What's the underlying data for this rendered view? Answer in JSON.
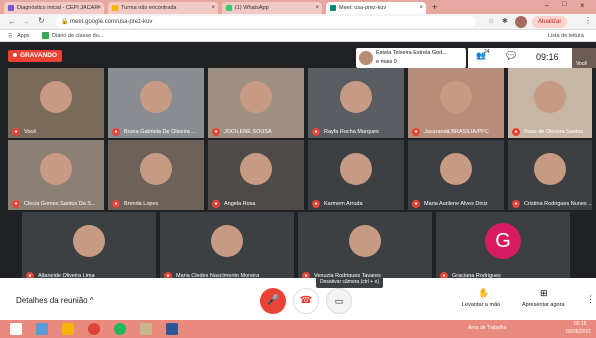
{
  "tabs": [
    {
      "label": "Diagnóstico inicial - CEPI JACAR",
      "color": "#7e57c2"
    },
    {
      "label": "Turma não encontrada",
      "color": "#f4b400"
    },
    {
      "label": "(1) WhatsApp",
      "color": "#25d366"
    },
    {
      "label": "Meet: usa-prez-kuv",
      "color": "#00897b"
    }
  ],
  "browser": {
    "url": "meet.google.com/usa-prez-kuv",
    "update_label": "Atualizar",
    "bookmarks": [
      "Apps",
      "Diário de classe do..."
    ],
    "reading_list": "Lista de leitura"
  },
  "meet": {
    "recording_label": "GRAVANDO",
    "presenter": {
      "line1": "Estela Teixeira Estrela God...",
      "line2": "e mais 9"
    },
    "participant_count": "24",
    "time": "09:16",
    "self_label": "Você",
    "participants": [
      {
        "name": "Você",
        "bg": "#7a6a5a"
      },
      {
        "name": "Bruna Gabriela De Oliveira ...",
        "bg": "#8a8e93"
      },
      {
        "name": "JOCILENE SOUSA",
        "bg": "#9e8f82"
      },
      {
        "name": "Rayfa Rocha Marques",
        "bg": "#5a5e63"
      },
      {
        "name": "Jacarandá BRASILIA/PPC",
        "bg": "#b58d7a"
      },
      {
        "name": "Rose de Oliveira Santos",
        "bg": "#c7b6a5"
      },
      {
        "name": "Clecia Gomes Santos Da S...",
        "bg": "#8c7f73"
      },
      {
        "name": "Brenda Lopes",
        "bg": "#6d625a"
      },
      {
        "name": "Angela Rosa",
        "bg": "#4e4a47"
      },
      {
        "name": "Karmem Arruda",
        "bg": "#3c4043"
      },
      {
        "name": "Maria Aurilene Alves Diniz",
        "bg": "#3c4043"
      },
      {
        "name": "Cristina Rodrigues Nunes ...",
        "bg": "#3c4043"
      },
      {
        "name": "Altaneide Oliveira Lima",
        "bg": "#3c4043"
      },
      {
        "name": "Maria Cledes Nascimento Moreira",
        "bg": "#3c4043"
      },
      {
        "name": "Venuzia Rodrigues Tavares",
        "bg": "#3c4043"
      },
      {
        "name": "Graciana Rodrigues",
        "bg": "#3c4043",
        "initial": "G"
      }
    ],
    "tooltip": "Desativar câmera (ctrl + e)",
    "meeting_details": "Detalhes da reunião",
    "raise_hand": "Levantar a mão",
    "present_now": "Apresentar agora"
  },
  "taskbar": {
    "weather": "Área de Trabalho",
    "time": "09:16",
    "date": "02/06/2021"
  }
}
